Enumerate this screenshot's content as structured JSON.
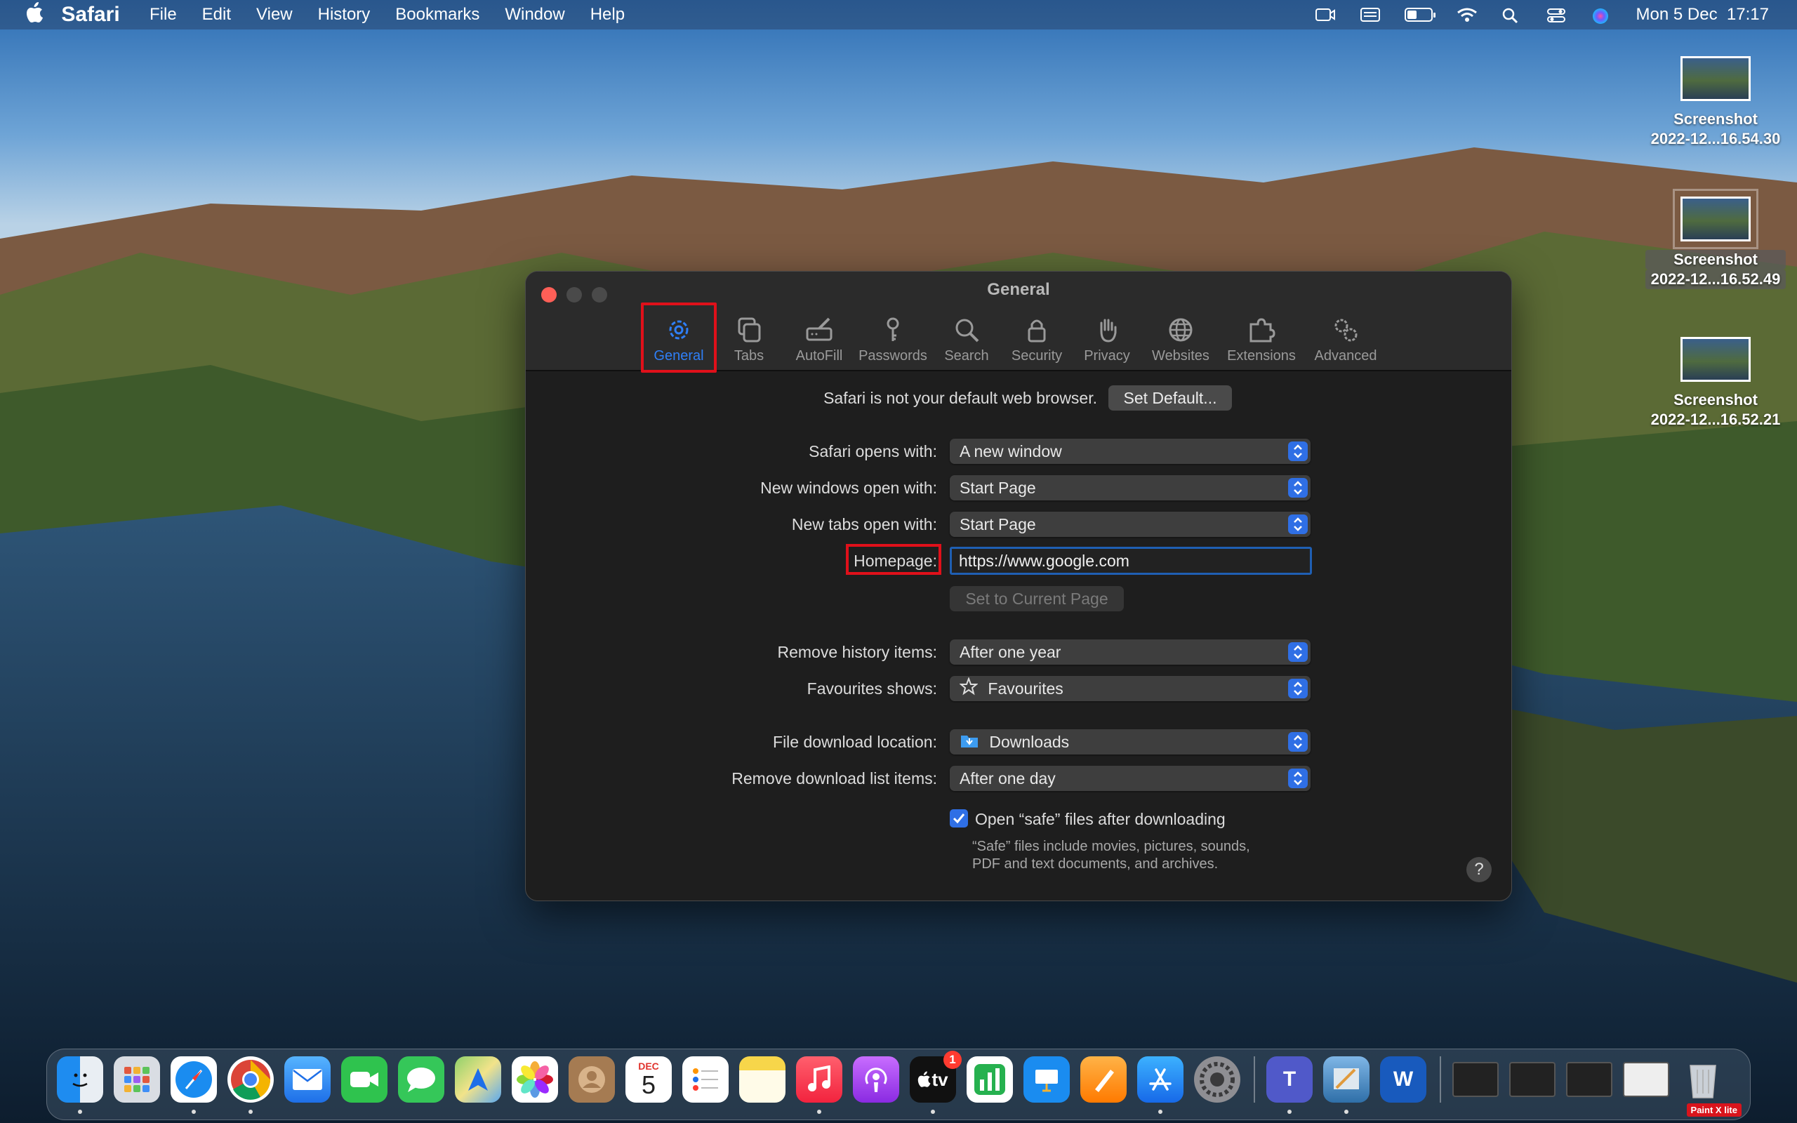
{
  "menubar": {
    "app": "Safari",
    "items": [
      "File",
      "Edit",
      "View",
      "History",
      "Bookmarks",
      "Window",
      "Help"
    ],
    "clock": "Mon 5 Dec  17:17",
    "battery_fraction": 0.4
  },
  "desktop_files": [
    {
      "line1": "Screenshot",
      "line2": "2022-12...16.54.30"
    },
    {
      "line1": "Screenshot",
      "line2": "2022-12...16.52.49"
    },
    {
      "line1": "Screenshot",
      "line2": "2022-12...16.52.21"
    }
  ],
  "window": {
    "title": "General",
    "tabs": [
      {
        "label": "General",
        "icon": "gear-icon"
      },
      {
        "label": "Tabs",
        "icon": "tabs-icon"
      },
      {
        "label": "AutoFill",
        "icon": "pencil-field-icon"
      },
      {
        "label": "Passwords",
        "icon": "key-icon"
      },
      {
        "label": "Search",
        "icon": "magnifier-icon"
      },
      {
        "label": "Security",
        "icon": "lock-icon"
      },
      {
        "label": "Privacy",
        "icon": "hand-icon"
      },
      {
        "label": "Websites",
        "icon": "globe-icon"
      },
      {
        "label": "Extensions",
        "icon": "puzzle-icon"
      },
      {
        "label": "Advanced",
        "icon": "gears-icon"
      }
    ]
  },
  "general": {
    "default_message": "Safari is not your default web browser.",
    "set_default": "Set Default...",
    "safari_opens_label": "Safari opens with:",
    "safari_opens_value": "A new window",
    "new_windows_label": "New windows open with:",
    "new_windows_value": "Start Page",
    "new_tabs_label": "New tabs open with:",
    "new_tabs_value": "Start Page",
    "homepage_label": "Homepage:",
    "homepage_value": "https://www.google.com",
    "set_current": "Set to Current Page",
    "remove_history_label": "Remove history items:",
    "remove_history_value": "After one year",
    "favourites_label": "Favourites shows:",
    "favourites_value": "Favourites",
    "download_location_label": "File download location:",
    "download_location_value": "Downloads",
    "remove_download_label": "Remove download list items:",
    "remove_download_value": "After one day",
    "open_safe_label": "Open “safe” files after downloading",
    "open_safe_checked": true,
    "safe_note_line1": "“Safe” files include movies, pictures, sounds,",
    "safe_note_line2": "PDF and text documents, and archives.",
    "help": "?"
  },
  "dock": {
    "calendar_month": "DEC",
    "calendar_day": "5",
    "tv_label": "tv",
    "tv_badge": "1",
    "word_letter": "W",
    "teams_letter": "T",
    "watermark": "Paint X lite"
  }
}
